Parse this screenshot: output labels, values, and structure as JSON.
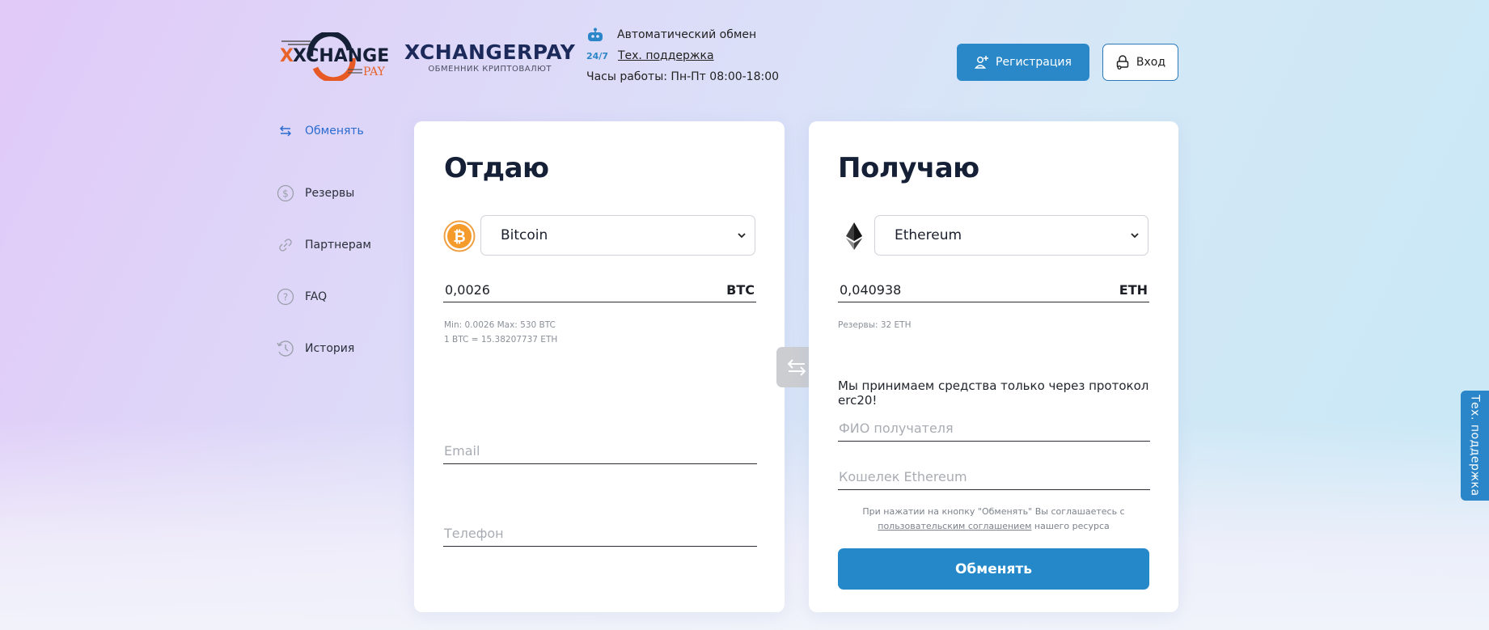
{
  "header": {
    "logo_text": "XCHANGER",
    "logo_sub": "PAY",
    "brand_title": "XCHANGERPAY",
    "brand_subtitle": "ОБМЕННИК КРИПТОВАЛЮТ",
    "auto_exchange": "Автоматический обмен",
    "badge_247": "24/7",
    "support_link": "Тех. поддержка",
    "hours": "Часы работы: Пн-Пт 08:00-18:00",
    "register_label": "Регистрация",
    "login_label": "Вход"
  },
  "sidebar": {
    "items": [
      {
        "label": "Обменять",
        "icon": "swap-arrows-icon",
        "active": true
      },
      {
        "label": "Резервы",
        "icon": "dollar-circle-icon",
        "active": false
      },
      {
        "label": "Партнерам",
        "icon": "link-icon",
        "active": false
      },
      {
        "label": "FAQ",
        "icon": "question-circle-icon",
        "active": false
      },
      {
        "label": "История",
        "icon": "history-icon",
        "active": false
      }
    ]
  },
  "give": {
    "title": "Отдаю",
    "currency": "Bitcoin",
    "amount": "0,0026",
    "ticker": "BTC",
    "limits": "Min: 0.0026 Max: 530 BTC",
    "rate": "1 BTC = 15.38207737 ETH",
    "email_placeholder": "Email",
    "phone_placeholder": "Телефон"
  },
  "receive": {
    "title": "Получаю",
    "currency": "Ethereum",
    "amount": "0,040938",
    "ticker": "ETH",
    "reserves": "Резервы: 32 ETH",
    "notice": "Мы принимаем средства только через протокол erc20!",
    "name_placeholder": "ФИО получателя",
    "wallet_placeholder": "Кошелек Ethereum",
    "agree_prefix": "При нажатии на кнопку \"Обменять\" Вы соглашаетесь с",
    "agree_link": "пользовательским соглашением",
    "agree_suffix": "нашего ресурса",
    "exchange_label": "Обменять"
  },
  "support_tab": "Тех. поддержка",
  "colors": {
    "accent": "#2588c9",
    "active_nav": "#2a6bd0",
    "heading": "#152036",
    "bitcoin": "#f7931a"
  }
}
